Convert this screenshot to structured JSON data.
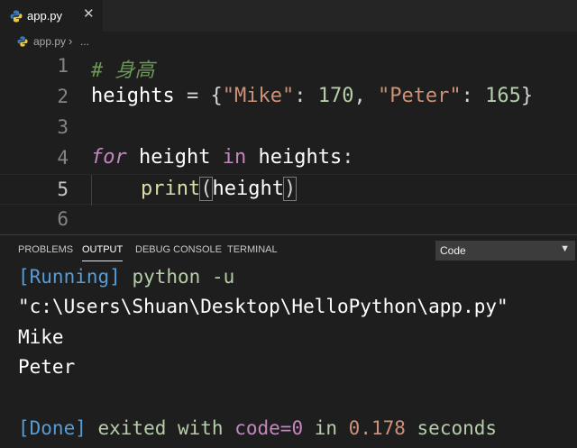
{
  "tab": {
    "label": "app.py",
    "close": "✕"
  },
  "breadcrumb": {
    "file": "app.py",
    "separator": "›",
    "more": "..."
  },
  "editor": {
    "line_numbers": [
      "1",
      "2",
      "3",
      "4",
      "5",
      "6"
    ],
    "line1": {
      "comment": "# 身高"
    },
    "line2": {
      "var": "heights",
      "eq": " = ",
      "open": "{",
      "k1": "\"Mike\"",
      "colon1": ": ",
      "v1": "170",
      "comma": ", ",
      "k2": "\"Peter\"",
      "colon2": ": ",
      "v2": "165",
      "close": "}"
    },
    "line4": {
      "kw_for": "for",
      "sp1": " ",
      "var": "height",
      "sp2": " ",
      "kw_in": "in",
      "sp3": " ",
      "iter": "heights",
      "colon": ":"
    },
    "line5": {
      "fn": "print",
      "open": "(",
      "arg": "height",
      "close": ")"
    }
  },
  "panel": {
    "tabs": [
      "PROBLEMS",
      "OUTPUT",
      "DEBUG CONSOLE",
      "TERMINAL"
    ],
    "active_tab": "OUTPUT",
    "select_value": "Code",
    "select_arrow": "▼"
  },
  "output": {
    "running": "[Running]",
    "cmd": " python -u",
    "path": "\"c:\\Users\\Shuan\\Desktop\\HelloPython\\app.py\"",
    "lines": [
      "Mike",
      "Peter"
    ],
    "done": "[Done]",
    "exited": " exited with ",
    "code_label": "code=0",
    "in": " in ",
    "seconds_value": "0.178",
    "seconds": " seconds"
  },
  "colors": {
    "keyword": "#c586c0",
    "string": "#ce9178",
    "number": "#b5cea8",
    "comment": "#6a9955",
    "function": "#dcdcaa",
    "info": "#569cd6"
  }
}
